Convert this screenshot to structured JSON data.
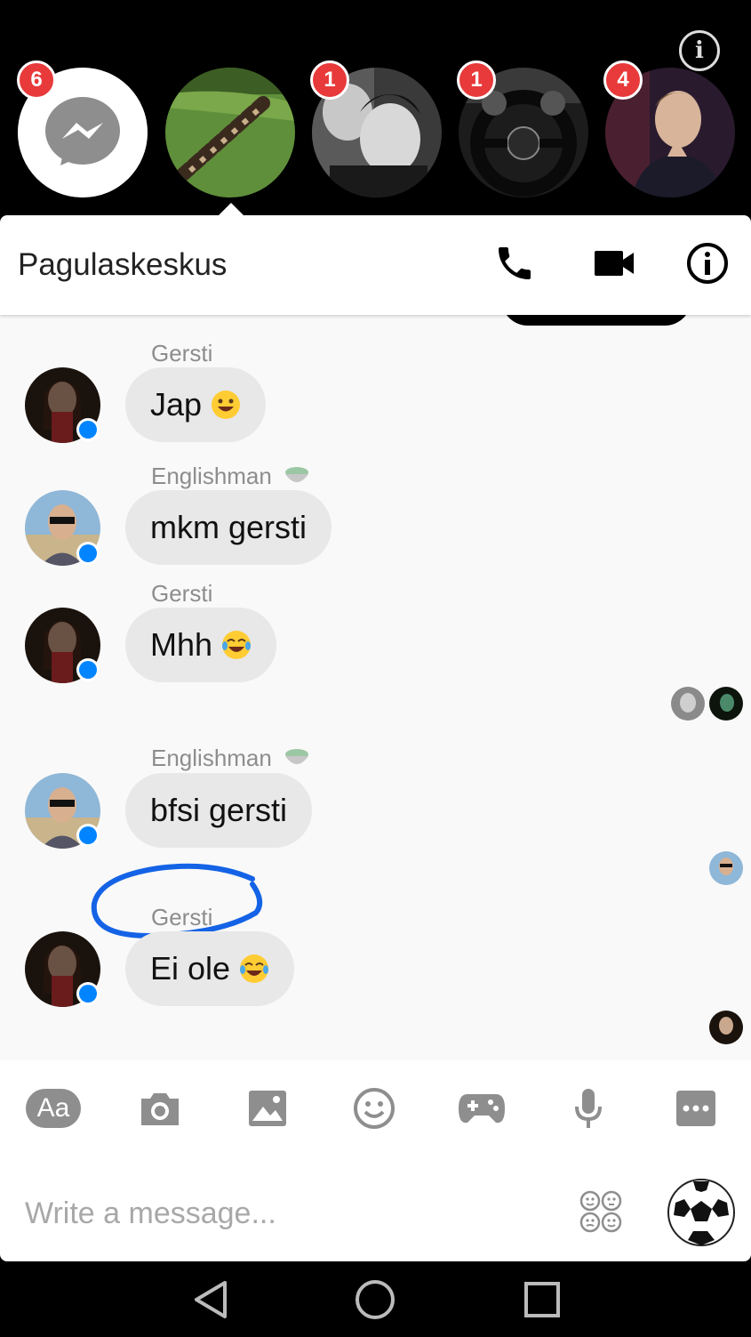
{
  "heads": {
    "info_label": "i",
    "items": [
      {
        "name": "messenger-head",
        "badge": "6"
      },
      {
        "name": "dogs-group-head",
        "badge": ""
      },
      {
        "name": "couple-head",
        "badge": "1"
      },
      {
        "name": "steering-wheel-head",
        "badge": "1"
      },
      {
        "name": "man-head",
        "badge": "4"
      }
    ]
  },
  "header": {
    "title": "Pagulaskeskus",
    "icons": [
      "phone-icon",
      "video-camera-icon",
      "info-icon"
    ]
  },
  "messages": [
    {
      "sender": "Gersti",
      "text": "Jap",
      "emoji": "grinning-face",
      "sender_emoji": ""
    },
    {
      "sender": "Englishman",
      "text": "mkm gersti",
      "emoji": "",
      "sender_emoji": "bowl-icon"
    },
    {
      "sender": "Gersti",
      "text": "Mhh",
      "emoji": "tears-of-joy",
      "sender_emoji": ""
    },
    {
      "sender": "Englishman",
      "text": "bfsi gersti",
      "emoji": "",
      "sender_emoji": "bowl-icon"
    },
    {
      "sender": "Gersti",
      "text": "Ei ole",
      "emoji": "tears-of-joy",
      "sender_emoji": ""
    }
  ],
  "toolbar": {
    "text_label": "Aa",
    "icons": [
      "text-style-icon",
      "camera-icon",
      "image-icon",
      "emoji-icon",
      "game-controller-icon",
      "microphone-icon",
      "more-icon"
    ]
  },
  "composer": {
    "placeholder": "Write a message...",
    "value": "",
    "stickers_icon": "stickers-icon",
    "quick_reaction": "soccer-ball"
  },
  "colors": {
    "accent": "#0084ff",
    "badge": "#e83a3a",
    "bubble": "#e8e8e8",
    "annotation": "#1463e6"
  }
}
